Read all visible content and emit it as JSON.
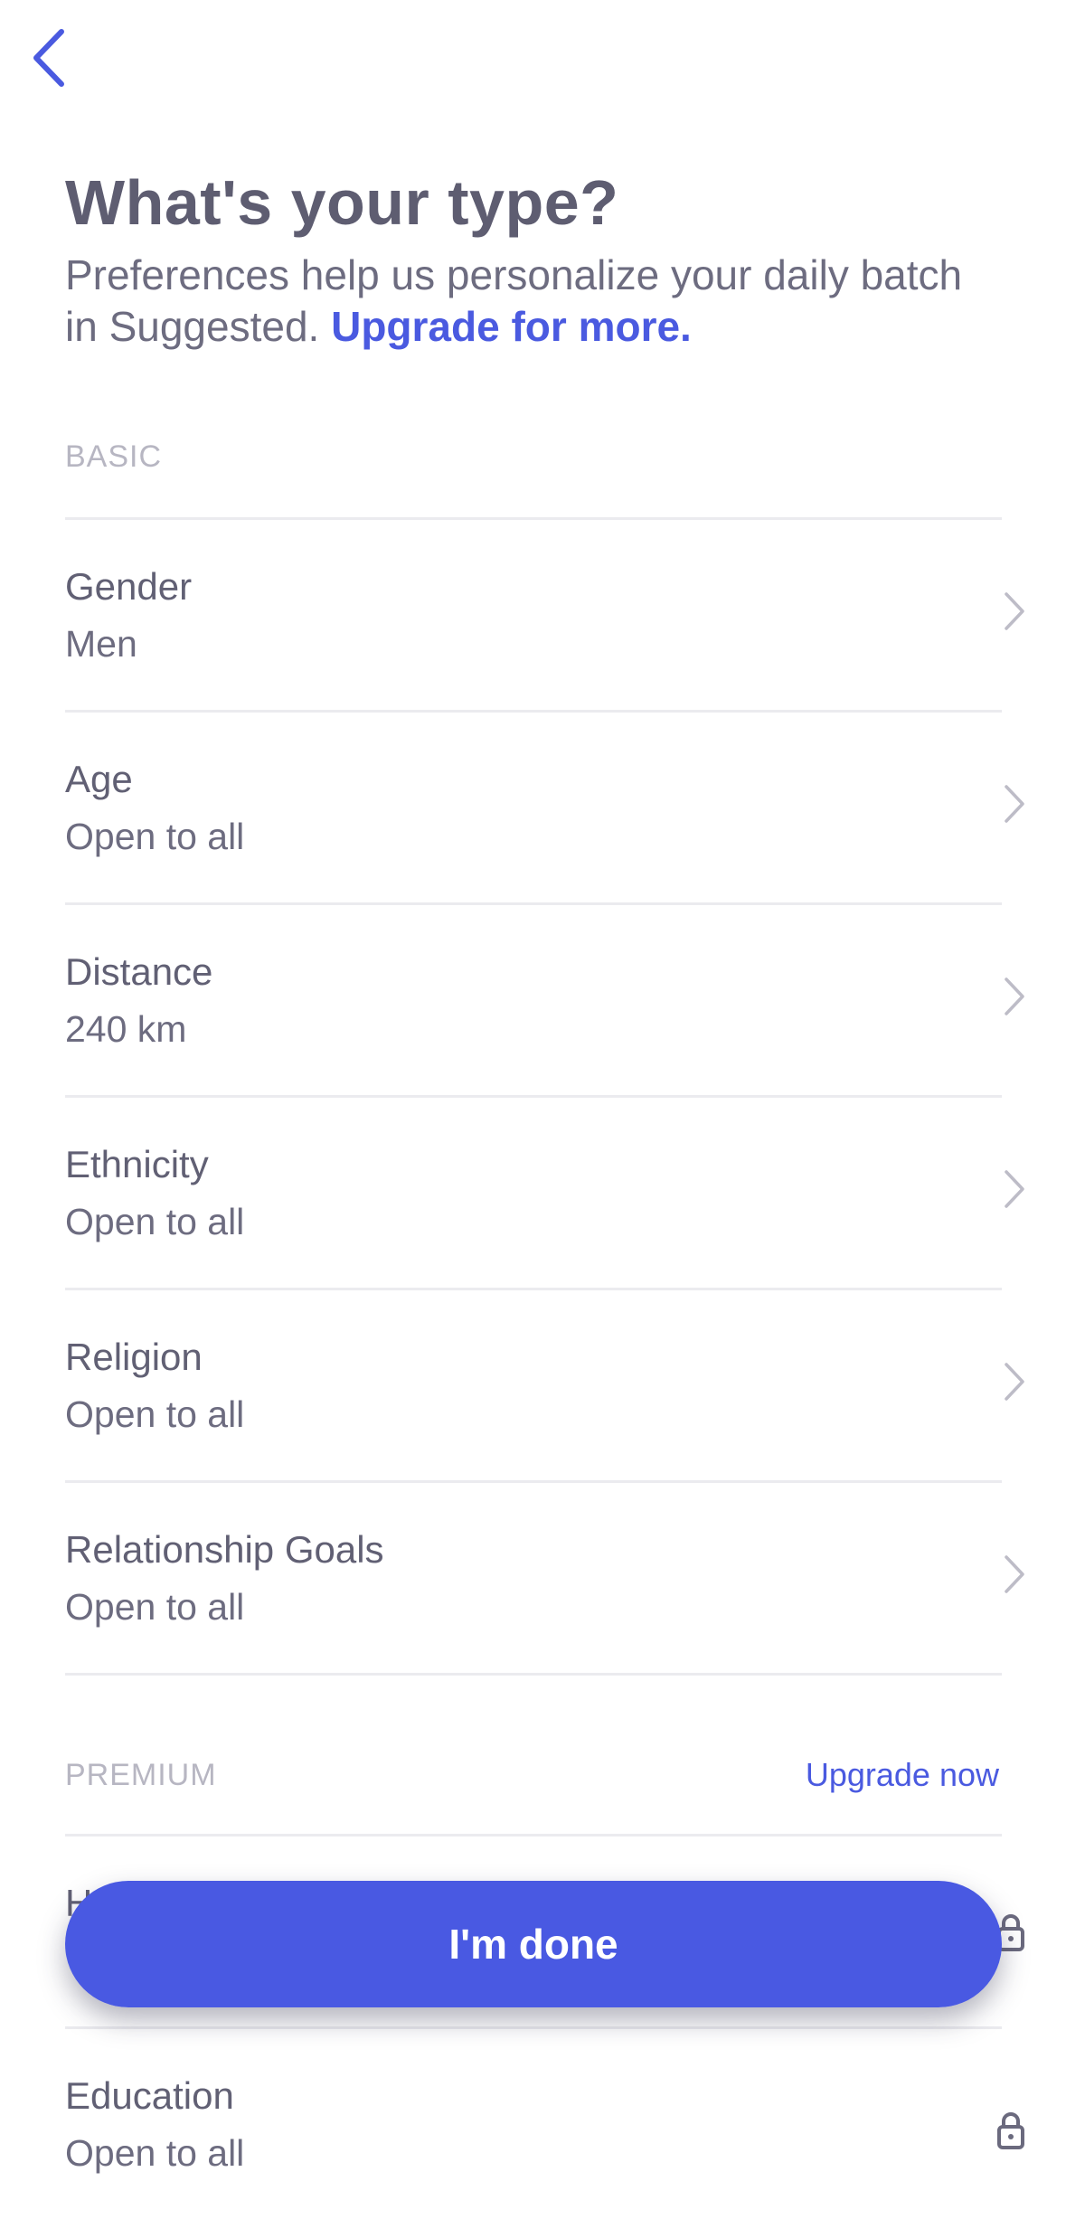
{
  "nav": {
    "back_icon": "chevron-left-icon"
  },
  "header": {
    "title": "What's your type?",
    "subtitle": "Preferences help us personalize your daily batch in Suggested.",
    "upgrade_link": "Upgrade for more."
  },
  "basic": {
    "section_label": "BASIC",
    "items": [
      {
        "title": "Gender",
        "value": "Men"
      },
      {
        "title": "Age",
        "value": "Open to all"
      },
      {
        "title": "Distance",
        "value": "240 km"
      },
      {
        "title": "Ethnicity",
        "value": "Open to all"
      },
      {
        "title": "Religion",
        "value": "Open to all"
      },
      {
        "title": "Relationship Goals",
        "value": "Open to all"
      }
    ]
  },
  "premium": {
    "section_label": "PREMIUM",
    "upgrade_label": "Upgrade now",
    "items": [
      {
        "title": "H",
        "value": ""
      },
      {
        "title": "Education",
        "value": "Open to all"
      }
    ]
  },
  "footer": {
    "done_label": "I'm done"
  },
  "colors": {
    "accent": "#4959e2",
    "link": "#4a5ae0",
    "text": "#5e5d71",
    "section_label": "#b7b6c2",
    "divider": "#ebebef"
  }
}
